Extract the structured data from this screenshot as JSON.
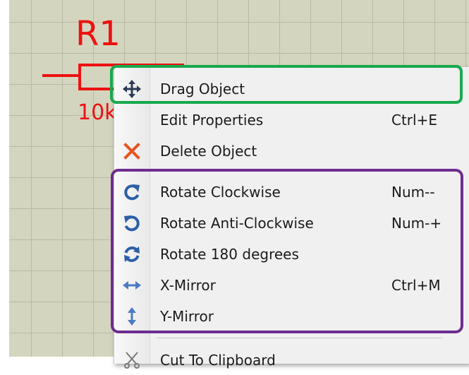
{
  "schematic": {
    "reference": "R1",
    "value": "10k"
  },
  "context_menu": {
    "items": [
      {
        "label": "Drag Object",
        "shortcut": "",
        "icon": "move-arrows-icon"
      },
      {
        "label": "Edit Properties",
        "shortcut": "Ctrl+E",
        "icon": ""
      },
      {
        "label": "Delete Object",
        "shortcut": "",
        "icon": "delete-x-icon"
      },
      {
        "label": "Rotate Clockwise",
        "shortcut": "Num--",
        "icon": "rotate-clockwise-icon"
      },
      {
        "label": "Rotate Anti-Clockwise",
        "shortcut": "Num-+",
        "icon": "rotate-anticlockwise-icon"
      },
      {
        "label": "Rotate 180 degrees",
        "shortcut": "",
        "icon": "rotate-180-icon"
      },
      {
        "label": "X-Mirror",
        "shortcut": "Ctrl+M",
        "icon": "x-mirror-icon"
      },
      {
        "label": "Y-Mirror",
        "shortcut": "",
        "icon": "y-mirror-icon"
      },
      {
        "label": "Cut To Clipboard",
        "shortcut": "",
        "icon": "scissors-icon"
      }
    ]
  },
  "colors": {
    "wire": "#ee1111",
    "icon_blue": "#2c5fa8",
    "delete_orange": "#e8531f",
    "highlight_green": "#17a94e",
    "highlight_purple": "#6e2d91"
  }
}
